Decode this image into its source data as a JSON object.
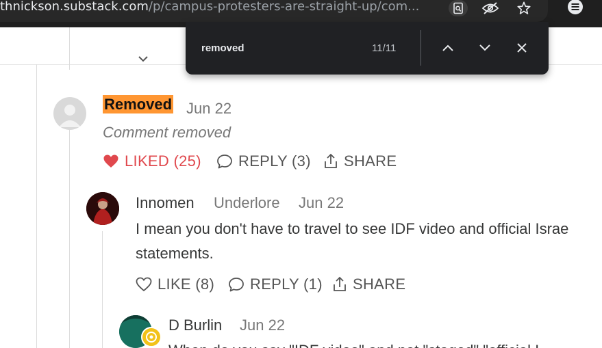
{
  "browser": {
    "url_host": "thnickson.substack.com",
    "url_path": "/p/campus-protesters-are-straight-up/com...",
    "icons": [
      "find-in-page-icon",
      "eye-off-icon",
      "star-icon",
      "menu-icon"
    ]
  },
  "find_bar": {
    "query": "removed",
    "match_count": "11/11",
    "icons": [
      "chevron-up-icon",
      "chevron-down-icon",
      "close-icon"
    ]
  },
  "comments": [
    {
      "author": "Removed",
      "author_highlighted": true,
      "date": "Jun 22",
      "text": "Comment removed",
      "text_italic": true,
      "actions": {
        "like_label": "LIKED (25)",
        "liked": true,
        "reply_label": "REPLY (3)",
        "share_label": "SHARE"
      }
    },
    {
      "author": "Innomen",
      "badge": "Underlore",
      "date": "Jun 22",
      "text_line1": "I mean you don't have to travel to see IDF video and official Israe",
      "text_line2": "statements.",
      "actions": {
        "like_label": "LIKE (8)",
        "liked": false,
        "reply_label": "REPLY (1)",
        "share_label": "SHARE"
      }
    },
    {
      "author": "D Burlin",
      "date": "Jun 22",
      "text_partial": "When do you say \"IDF video\" and not \"staged\" \"official I"
    }
  ],
  "colors": {
    "liked_red": "#e0484d",
    "find_highlight": "#ff9632",
    "chrome_dark": "#1f1f1f"
  }
}
